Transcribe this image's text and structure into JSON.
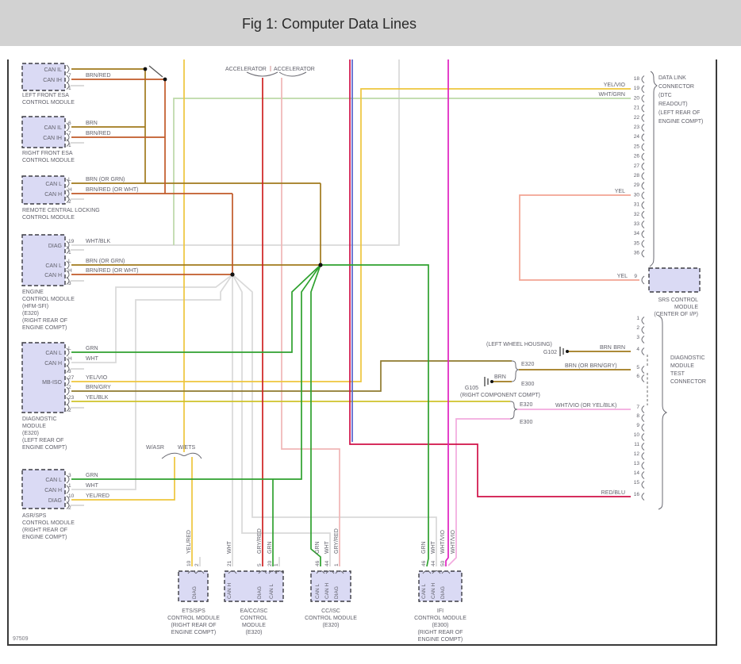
{
  "title": "Fig 1: Computer Data Lines",
  "doc_number": "97509",
  "accelerator": {
    "left": "ACCELERATOR",
    "right": "ACCELERATOR"
  },
  "taps": {
    "wasr": "W/ASR",
    "wets": "W/ETS"
  },
  "m": {
    "lf": {
      "name": [
        "LEFT FRONT ESA",
        "CONTROL MODULE"
      ],
      "can_il": "CAN IL",
      "can_ih": "CAN IH",
      "pin_ih": "7",
      "wire_ih": "BRN/RED",
      "pin_b": "1"
    },
    "rf": {
      "name": [
        "RIGHT FRONT ESA",
        "CONTROL MODULE"
      ],
      "can_il": "CAN IL",
      "can_ih": "CAN IH",
      "pin_il": "6",
      "wire_il": "BRN",
      "pin_ih": "7",
      "wire_ih": "BRN/RED",
      "pin_b": "1"
    },
    "rcl": {
      "name": [
        "REMOTE CENTRAL LOCKING",
        "CONTROL MODULE"
      ],
      "can_l": "CAN L",
      "can_h": "CAN H",
      "pin_l": "L",
      "wire_l": "BRN (OR GRN)",
      "pin_h": "H",
      "wire_h": "BRN/RED (OR WHT)",
      "pin_b": "2"
    },
    "ecm": {
      "name": [
        "ENGINE",
        "CONTROL MODULE",
        "(HFM-SFI)",
        "(E320)",
        "(RIGHT REAR OF",
        "ENGINE COMPT)"
      ],
      "diag": "DIAG",
      "pin_diag": "19",
      "wire_diag": "WHT/BLK",
      "pin_1": "1",
      "can_l": "CAN L",
      "pin_l": "L",
      "wire_l": "BRN (OR GRN)",
      "can_h": "CAN H",
      "pin_h": "H",
      "wire_h": "BRN/RED (OR WHT)",
      "pin_b": "3"
    },
    "dm": {
      "name": [
        "DIAGNOSTIC",
        "MODULE",
        "(E320)",
        "(LEFT REAR OF",
        "ENGINE COMPT)"
      ],
      "can_l": "CAN L",
      "pin_l": "L",
      "wire_l": "GRN",
      "can_h": "CAN H",
      "pin_h": "H",
      "wire_h": "WHT",
      "pin_3": "3",
      "mb_iso": "MB-ISO",
      "pin_27": "27",
      "wire_27": "YEL/VIO",
      "pin_2": "2",
      "wire_2": "BRN/GRY",
      "pin_23": "23",
      "wire_23": "YEL/BLK",
      "pin_b": "2"
    },
    "asr": {
      "name": [
        "ASR/SPS",
        "CONTROL MODULE",
        "(RIGHT REAR OF",
        "ENGINE COMPT)"
      ],
      "can_l": "CAN L",
      "pin_l": "3",
      "wire_l": "GRN",
      "can_h": "CAN H",
      "pin_h": "1",
      "wire_h": "WHT",
      "diag": "DIAG",
      "pin_diag": "10",
      "wire_diag": "YEL/RED",
      "pin_b": "2"
    },
    "ets": {
      "name": [
        "ETS/SPS",
        "CONTROL MODULE",
        "(RIGHT REAR OF",
        "ENGINE COMPT)"
      ],
      "rows": [
        "DIAG"
      ],
      "pins": [
        "10",
        "2"
      ],
      "wires": [
        "YEL/RED"
      ]
    },
    "ea": {
      "name": [
        "EA/CC/ISC",
        "CONTROL",
        "MODULE",
        "(E320)"
      ],
      "rows": [
        "CAN H",
        "DIAG",
        "CAN L"
      ],
      "pins": [
        "21",
        "5",
        "20",
        "1"
      ],
      "wires": [
        "WHT",
        "GRY/RED",
        "GRN"
      ]
    },
    "cc": {
      "name": [
        "CC/ISC",
        "CONTROL MODULE",
        "(E320)"
      ],
      "rows": [
        "CAN L",
        "CAN H",
        "DIAG"
      ],
      "pins": [
        "46",
        "44",
        "1"
      ],
      "wires": [
        "GRN",
        "WHT",
        "GRY/RED"
      ]
    },
    "ifi": {
      "name": [
        "IFI",
        "CONTROL MODULE",
        "(E300)",
        "(RIGHT REAR OF",
        "ENGINE COMPT)"
      ],
      "rows": [
        "CAN L",
        "CAN H",
        "DIAG"
      ],
      "pins": [
        "46",
        "44",
        "50"
      ],
      "wires": [
        "GRN",
        "WHT",
        "WHT/VIO",
        "WHT/VIO"
      ]
    },
    "srs": {
      "name": [
        "SRS CONTROL",
        "MODULE",
        "(CENTER OF I/P)"
      ],
      "pin": "9",
      "wire": "YEL"
    }
  },
  "dlc": {
    "name": [
      "DATA LINK",
      "CONNECTOR",
      "(DTC",
      "READOUT)",
      "(LEFT REAR OF",
      "ENGINE COMPT)"
    ],
    "pins": [
      "18",
      "19",
      "20",
      "21",
      "22",
      "23",
      "24",
      "25",
      "26",
      "27",
      "28",
      "29",
      "30",
      "31",
      "32",
      "33",
      "34",
      "35",
      "36"
    ],
    "wire_19": "YEL/VIO",
    "wire_20": "WHT/GRN",
    "wire_30": "YEL"
  },
  "dmtc": {
    "name": [
      "DIAGNOSTIC",
      "MODULE",
      "TEST",
      "CONNECTOR"
    ],
    "pins": [
      "1",
      "2",
      "3",
      "4",
      "5",
      "6",
      "7",
      "8",
      "9",
      "10",
      "11",
      "12",
      "13",
      "14",
      "15",
      "16"
    ],
    "wire_4": "BRN",
    "wire_5": "BRN (OR BRN/GRY)",
    "wire_7": "WHT/VIO (OR YEL/BLK)",
    "wire_16": "RED/BLU"
  },
  "grounds": {
    "g102": "G102",
    "g102_loc": "(LEFT WHEEL HOUSING)",
    "g102_wire": "BRN",
    "g105": "G105",
    "g105_loc": "(RIGHT COMPONENT COMPT)",
    "g105_wire": "BRN"
  },
  "splices": {
    "e320_a": "E320",
    "e300_a": "E300",
    "e320_b": "E320",
    "e300_b": "E300"
  },
  "colors": {
    "brn": "#a1791c",
    "brn_red": "#c05a28",
    "wht": "#d9d9d9",
    "wht_grn": "#bcd9a8",
    "grn": "#2ea12e",
    "yel": "#eec63c",
    "yel_blk": "#cfc229",
    "brn_gry": "#8f7a2e",
    "gry_red": "#cf2020",
    "gry_red_lt": "#f0b6b6",
    "yel_salmon": "#f2a492",
    "red_blu": "#d01048",
    "blu": "#5560cc",
    "wht_vio": "#e020c0",
    "wht_vio_lt": "#f2aade",
    "banner": "#d2d2d2",
    "module_fill": "#dadaf4"
  }
}
